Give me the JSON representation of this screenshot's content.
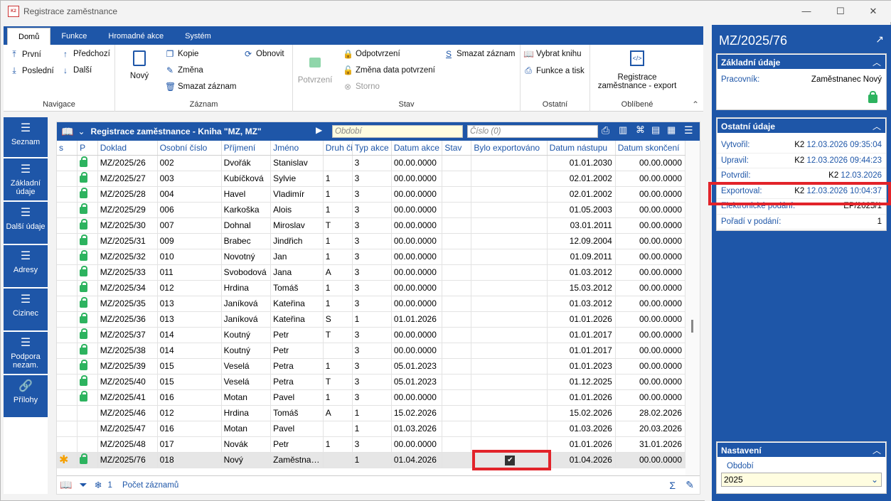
{
  "window": {
    "title": "Registrace zaměstnance",
    "logo": "K2",
    "minimize": "—",
    "maximize": "☐",
    "close": "✕"
  },
  "ribbon": {
    "tabs": [
      "Domů",
      "Funkce",
      "Hromadné akce",
      "Systém"
    ],
    "navigace": {
      "label": "Navigace",
      "prvni": "První",
      "predchozi": "Předchozí",
      "posledni": "Poslední",
      "dalsi": "Další"
    },
    "zaznam": {
      "label": "Záznam",
      "novy": "Nový",
      "kopie": "Kopie",
      "obnovit": "Obnovit",
      "zmena": "Změna",
      "smazat": "Smazat záznam"
    },
    "stav": {
      "label": "Stav",
      "potvrzeni": "Potvrzení",
      "odpotvrzeni": "Odpotvrzení",
      "zmena_data": "Změna data potvrzení",
      "storno": "Storno",
      "smazat": "Smazat záznam"
    },
    "ostatni": {
      "label": "Ostatní",
      "vybrat_knihu": "Vybrat knihu",
      "funkce_tisk": "Funkce a tisk"
    },
    "oblibene": {
      "label": "Oblíbené",
      "export_line1": "Registrace",
      "export_line2": "zaměstnance - export"
    }
  },
  "nav": [
    {
      "label": "Seznam"
    },
    {
      "label": "Základní údaje"
    },
    {
      "label": "Další údaje"
    },
    {
      "label": "Adresy"
    },
    {
      "label": "Cizinec"
    },
    {
      "label": "Podpora nezam."
    },
    {
      "label": "Přílohy"
    }
  ],
  "grid": {
    "title": "Registrace zaměstnance - Kniha \"MZ, MZ\"",
    "obdobi_placeholder": "Období",
    "cislo_placeholder": "Číslo (0)",
    "columns": [
      "s",
      "P",
      "Doklad",
      "Osobní číslo",
      "Příjmení",
      "Jméno",
      "Druh či",
      "Typ akce",
      "Datum akce",
      "Stav",
      "Bylo exportováno",
      "Datum nástupu",
      "Datum skončení"
    ],
    "rows": [
      [
        "",
        "lock",
        "MZ/2025/26",
        "002",
        "Dvořák",
        "Stanislav",
        "",
        "3",
        "00.00.0000",
        "",
        "",
        "01.01.2030",
        "00.00.0000"
      ],
      [
        "",
        "lock",
        "MZ/2025/27",
        "003",
        "Kubíčková",
        "Sylvie",
        "1",
        "3",
        "00.00.0000",
        "",
        "",
        "02.01.2002",
        "00.00.0000"
      ],
      [
        "",
        "lock",
        "MZ/2025/28",
        "004",
        "Havel",
        "Vladimír",
        "1",
        "3",
        "00.00.0000",
        "",
        "",
        "02.01.2002",
        "00.00.0000"
      ],
      [
        "",
        "lock",
        "MZ/2025/29",
        "006",
        "Karkoška",
        "Alois",
        "1",
        "3",
        "00.00.0000",
        "",
        "",
        "01.05.2003",
        "00.00.0000"
      ],
      [
        "",
        "lock",
        "MZ/2025/30",
        "007",
        "Dohnal",
        "Miroslav",
        "T",
        "3",
        "00.00.0000",
        "",
        "",
        "03.01.2011",
        "00.00.0000"
      ],
      [
        "",
        "lock",
        "MZ/2025/31",
        "009",
        "Brabec",
        "Jindřich",
        "1",
        "3",
        "00.00.0000",
        "",
        "",
        "12.09.2004",
        "00.00.0000"
      ],
      [
        "",
        "lock",
        "MZ/2025/32",
        "010",
        "Novotný",
        "Jan",
        "1",
        "3",
        "00.00.0000",
        "",
        "",
        "01.09.2011",
        "00.00.0000"
      ],
      [
        "",
        "lock",
        "MZ/2025/33",
        "011",
        "Svobodová",
        "Jana",
        "A",
        "3",
        "00.00.0000",
        "",
        "",
        "01.03.2012",
        "00.00.0000"
      ],
      [
        "",
        "lock",
        "MZ/2025/34",
        "012",
        "Hrdina",
        "Tomáš",
        "1",
        "3",
        "00.00.0000",
        "",
        "",
        "15.03.2012",
        "00.00.0000"
      ],
      [
        "",
        "lock",
        "MZ/2025/35",
        "013",
        "Janíková",
        "Kateřina",
        "1",
        "3",
        "00.00.0000",
        "",
        "",
        "01.03.2012",
        "00.00.0000"
      ],
      [
        "",
        "lock",
        "MZ/2025/36",
        "013",
        "Janíková",
        "Kateřina",
        "S",
        "1",
        "01.01.2026",
        "",
        "",
        "01.01.2026",
        "00.00.0000"
      ],
      [
        "",
        "lock",
        "MZ/2025/37",
        "014",
        "Koutný",
        "Petr",
        "T",
        "3",
        "00.00.0000",
        "",
        "",
        "01.01.2017",
        "00.00.0000"
      ],
      [
        "",
        "lock",
        "MZ/2025/38",
        "014",
        "Koutný",
        "Petr",
        "",
        "3",
        "00.00.0000",
        "",
        "",
        "01.01.2017",
        "00.00.0000"
      ],
      [
        "",
        "lock",
        "MZ/2025/39",
        "015",
        "Veselá",
        "Petra",
        "1",
        "3",
        "05.01.2023",
        "",
        "",
        "01.01.2023",
        "00.00.0000"
      ],
      [
        "",
        "lock",
        "MZ/2025/40",
        "015",
        "Veselá",
        "Petra",
        "T",
        "3",
        "05.01.2023",
        "",
        "",
        "01.12.2025",
        "00.00.0000"
      ],
      [
        "",
        "lock",
        "MZ/2025/41",
        "016",
        "Motan",
        "Pavel",
        "1",
        "3",
        "00.00.0000",
        "",
        "",
        "01.01.2026",
        "00.00.0000"
      ],
      [
        "",
        "",
        "MZ/2025/46",
        "012",
        "Hrdina",
        "Tomáš",
        "A",
        "1",
        "15.02.2026",
        "",
        "",
        "15.02.2026",
        "28.02.2026"
      ],
      [
        "",
        "",
        "MZ/2025/47",
        "016",
        "Motan",
        "Pavel",
        "",
        "1",
        "01.03.2026",
        "",
        "",
        "01.03.2026",
        "20.03.2026"
      ],
      [
        "",
        "",
        "MZ/2025/48",
        "017",
        "Novák",
        "Petr",
        "1",
        "3",
        "00.00.0000",
        "",
        "",
        "01.01.2026",
        "31.01.2026"
      ],
      [
        "star",
        "lock",
        "MZ/2025/76",
        "018",
        "Nový",
        "Zaměstnanec",
        "",
        "1",
        "01.04.2026",
        "",
        "check",
        "01.04.2026",
        "00.00.0000"
      ]
    ],
    "footer_count": "1",
    "footer_label": "Počet záznamů"
  },
  "right": {
    "title": "MZ/2025/76",
    "zakladni": {
      "header": "Základní údaje",
      "pracovnik_label": "Pracovník:",
      "pracovnik_value": "Zaměstnanec Nový"
    },
    "ostatni": {
      "header": "Ostatní údaje",
      "rows": [
        {
          "label": "Vytvořil:",
          "user": "K2",
          "date": "12.03.2026 09:35:04"
        },
        {
          "label": "Upravil:",
          "user": "K2",
          "date": "12.03.2026 09:44:23"
        },
        {
          "label": "Potvrdil:",
          "user": "K2",
          "date": "12.03.2026"
        },
        {
          "label": "Exportoval:",
          "user": "K2",
          "date": "12.03.2026 10:04:37"
        },
        {
          "label": "Elektronické podání:",
          "user": "EP/2025/1",
          "date": ""
        },
        {
          "label": "Pořadí v podání:",
          "user": "1",
          "date": ""
        }
      ]
    },
    "nastaveni": {
      "header": "Nastavení",
      "obdobi_label": "Období",
      "obdobi_value": "2025"
    }
  },
  "colors": {
    "accent": "#1e56a8",
    "highlight": "#e2232a",
    "lock": "#2db35f"
  }
}
